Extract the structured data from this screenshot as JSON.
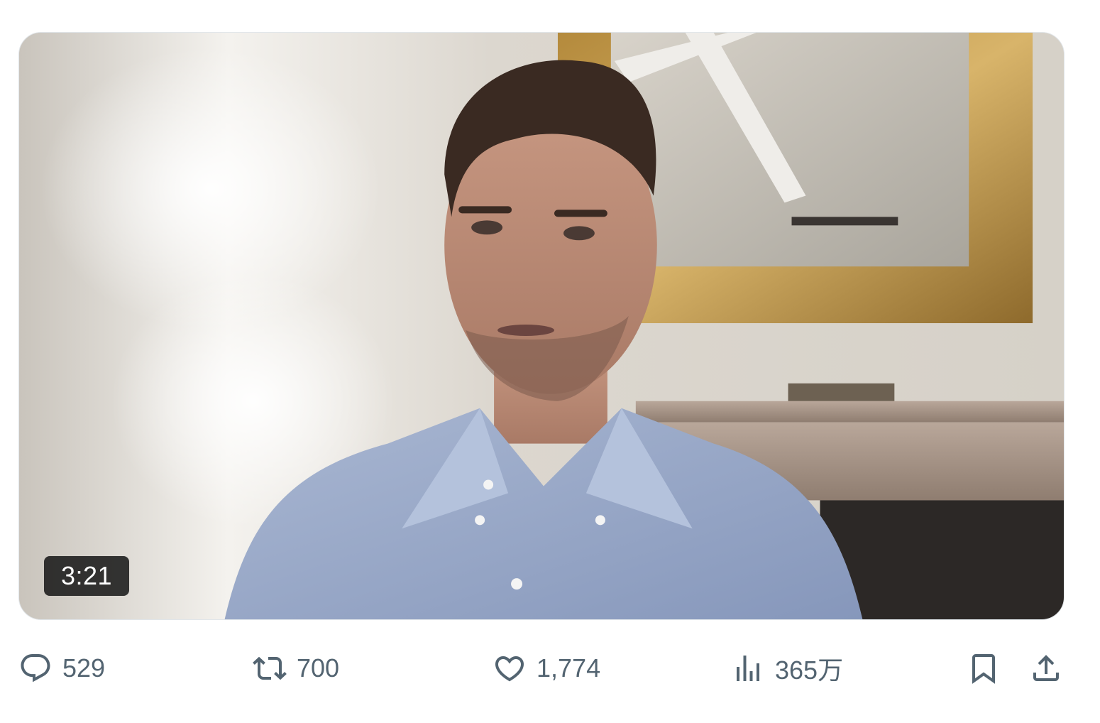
{
  "video": {
    "duration": "3:21"
  },
  "actions": {
    "reply": {
      "icon": "reply-icon",
      "count": "529"
    },
    "retweet": {
      "icon": "retweet-icon",
      "count": "700"
    },
    "like": {
      "icon": "heart-icon",
      "count": "1,774"
    },
    "views": {
      "icon": "views-chart-icon",
      "count": "365万"
    },
    "bookmark": {
      "icon": "bookmark-icon"
    },
    "share": {
      "icon": "share-upload-icon"
    }
  },
  "colors": {
    "action_gray": "#536471",
    "badge_bg": "#141414",
    "badge_text": "#ffffff",
    "border": "#e1e6ea"
  }
}
